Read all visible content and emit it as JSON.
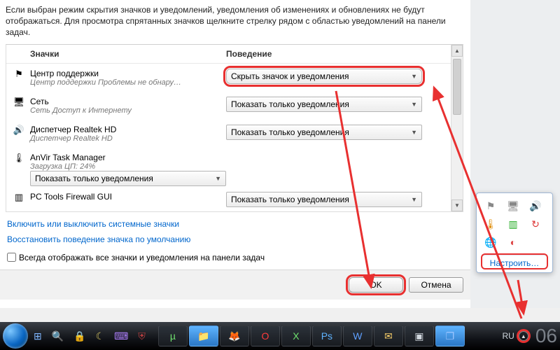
{
  "intro": "Если выбран режим скрытия значков и уведомлений, уведомления об изменениях и обновлениях не будут отображаться. Для просмотра спрятанных значков щелкните стрелку рядом с областью уведомлений на панели задач.",
  "headers": {
    "icons": "Значки",
    "behavior": "Поведение"
  },
  "combo_options": {
    "hide": "Скрыть значок и уведомления",
    "notify": "Показать только уведомления"
  },
  "rows": [
    {
      "icon": "⚑",
      "icon_name": "flag-icon",
      "title": "Центр поддержки",
      "sub": "Центр поддержки  Проблемы не обнару…",
      "combo": "hide",
      "highlight": true
    },
    {
      "icon": "🖥",
      "icon_name": "monitor-icon",
      "title": "Сеть",
      "sub": "Сеть Доступ к Интернету",
      "combo": "notify",
      "highlight": false
    },
    {
      "icon": "🔊",
      "icon_name": "speaker-icon",
      "title": "Диспетчер Realtek HD",
      "sub": "Диспетчер Realtek HD",
      "combo": "notify",
      "highlight": false
    },
    {
      "icon": "🌡",
      "icon_name": "anvir-icon",
      "title": "AnVir Task Manager",
      "sub": "Загрузка ЦП: 24%</…  Загрузка диска  C…",
      "combo": "notify",
      "highlight": false
    },
    {
      "icon": "▥",
      "icon_name": "firewall-icon",
      "title": "PC Tools Firewall GUI",
      "sub": "",
      "combo": "notify",
      "highlight": false
    }
  ],
  "links": {
    "toggle_system": "Включить или выключить системные значки",
    "restore_default": "Восстановить поведение значка по умолчанию"
  },
  "checkbox_label": "Всегда отображать все значки и уведомления на панели задач",
  "buttons": {
    "ok": "OK",
    "cancel": "Отмена"
  },
  "tray_popup": {
    "icons": [
      {
        "name": "flag-icon",
        "glyph": "⚑",
        "color": "#888"
      },
      {
        "name": "monitor-icon",
        "glyph": "🖥",
        "color": "#888"
      },
      {
        "name": "speaker-icon",
        "glyph": "🔊",
        "color": "#d33"
      },
      {
        "name": "anvir-icon",
        "glyph": "🌡",
        "color": "#d80"
      },
      {
        "name": "firewall-icon",
        "glyph": "▥",
        "color": "#2a2"
      },
      {
        "name": "sync-icon",
        "glyph": "↻",
        "color": "#d33"
      },
      {
        "name": "globe-icon",
        "glyph": "🌐",
        "color": "#28c"
      },
      {
        "name": "ccleaner-icon",
        "glyph": "◐",
        "color": "#d44"
      }
    ],
    "link": "Настроить…"
  },
  "taskbar": {
    "quick": [
      {
        "name": "desktop-icon",
        "glyph": "⊞",
        "color": "#7fb6ff"
      },
      {
        "name": "magnify-icon",
        "glyph": "🔍",
        "color": "#7fb6ff"
      },
      {
        "name": "lock-icon",
        "glyph": "🔒",
        "color": "#ffb060"
      },
      {
        "name": "sleep-icon",
        "glyph": "☾",
        "color": "#d0c060"
      },
      {
        "name": "keyboard-icon",
        "glyph": "⌨",
        "color": "#b080ff"
      },
      {
        "name": "shield-icon",
        "glyph": "⛨",
        "color": "#c04040"
      }
    ],
    "pinned": [
      {
        "name": "utorrent-icon",
        "glyph": "µ",
        "color": "#6fe26f"
      },
      {
        "name": "explorer-icon",
        "glyph": "📁",
        "color": "#ffd46b",
        "active": true
      },
      {
        "name": "firefox-icon",
        "glyph": "🦊",
        "color": "#ff7b29"
      },
      {
        "name": "opera-icon",
        "glyph": "O",
        "color": "#ff3b3b"
      },
      {
        "name": "excel-icon",
        "glyph": "X",
        "color": "#6fe26f"
      },
      {
        "name": "photoshop-icon",
        "glyph": "Ps",
        "color": "#5fb3ff"
      },
      {
        "name": "word-icon",
        "glyph": "W",
        "color": "#5fa0ff"
      },
      {
        "name": "mail-icon",
        "glyph": "✉",
        "color": "#ffd46b"
      },
      {
        "name": "app-icon",
        "glyph": "▣",
        "color": "#cfd6dd"
      },
      {
        "name": "window-icon",
        "glyph": "❐",
        "color": "#9fc6ff",
        "active": true
      }
    ],
    "lang": "RU",
    "clock_fragment": "06"
  },
  "annotations": {
    "arrow_color": "#e83030"
  }
}
